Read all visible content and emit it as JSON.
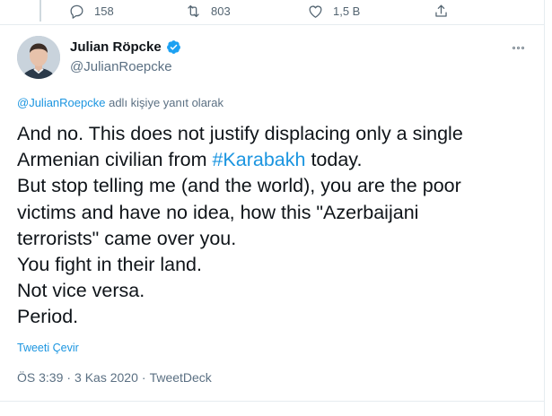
{
  "actions": {
    "reply_count": "158",
    "retweet_count": "803",
    "like_count": "1,5 B"
  },
  "author": {
    "name": "Julian Röpcke",
    "handle": "@JulianRoepcke",
    "verified_icon": "verified-badge-icon"
  },
  "reply_context": {
    "mention": "@JulianRoepcke",
    "suffix": " adlı kişiye yanıt olarak"
  },
  "tweet": {
    "line1_pre": "And no. This does not justify displacing only a single\nArmenian civilian from ",
    "hashtag": "#Karabakh",
    "line_rest": " today.\nBut stop telling me (and the world), you are the poor\nvictims and have no idea, how this \"Azerbaijani\nterrorists\" came over you.\nYou fight in their land.\nNot vice versa.\nPeriod."
  },
  "translate_label": "Tweeti Çevir",
  "meta": {
    "time": "ÖS 3:39",
    "sep1": "·",
    "date": "3 Kas 2020",
    "sep2": "·",
    "source": "TweetDeck"
  },
  "colors": {
    "accent": "#1b95e0",
    "verified": "#1da1f2",
    "muted": "#5b7083"
  }
}
